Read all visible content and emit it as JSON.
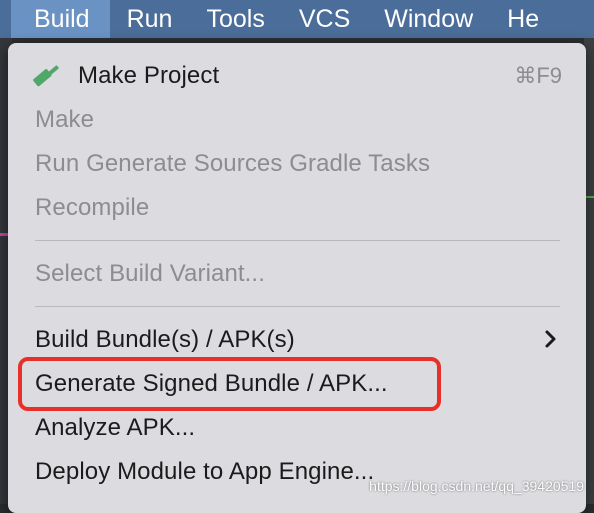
{
  "menubar": {
    "items": [
      "Build",
      "Run",
      "Tools",
      "VCS",
      "Window",
      "He"
    ]
  },
  "menu": {
    "make_project": {
      "label": "Make Project",
      "shortcut": "⌘F9",
      "icon": "hammer-icon"
    },
    "make": {
      "label": "Make"
    },
    "run_gradle": {
      "label": "Run Generate Sources Gradle Tasks"
    },
    "recompile": {
      "label": "Recompile"
    },
    "select_variant": {
      "label": "Select Build Variant..."
    },
    "build_bundle": {
      "label": "Build Bundle(s) / APK(s)",
      "submenu": "chevron-right-icon"
    },
    "generate_signed": {
      "label": "Generate Signed Bundle / APK..."
    },
    "analyze_apk": {
      "label": "Analyze APK..."
    },
    "deploy_module": {
      "label": "Deploy Module to App Engine..."
    }
  },
  "highlight_color": "#e8302a",
  "watermark": "https://blog.csdn.net/qq_39420519"
}
